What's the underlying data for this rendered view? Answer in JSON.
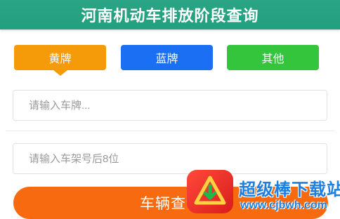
{
  "header": {
    "title": "河南机动车排放阶段查询"
  },
  "plate_tabs": [
    {
      "label": "黄牌",
      "color": "#f59a08",
      "selected": true
    },
    {
      "label": "蓝牌",
      "color": "#1a6ff2",
      "selected": false
    },
    {
      "label": "其他",
      "color": "#35c53d",
      "selected": false
    }
  ],
  "form": {
    "plate_placeholder": "请输入车牌...",
    "vin_placeholder": "请输入车架号后8位"
  },
  "query_button": {
    "label": "车辆查询",
    "color": "#f86a10"
  },
  "watermark": {
    "brand": "超级棒下载站",
    "url": "www.cjbwh.com"
  },
  "colors": {
    "header": "#23a07f",
    "accent": "#f86a10"
  }
}
